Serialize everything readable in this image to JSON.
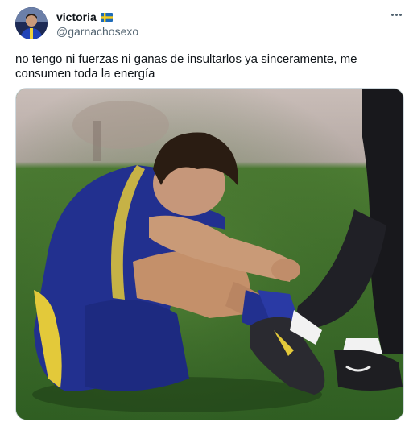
{
  "tweet": {
    "author": {
      "display_name": "victoria",
      "handle": "@garnachosexo",
      "flag_icon": "sweden-flag-icon",
      "avatar_icon": "avatar"
    },
    "text": "no tengo ni fuerzas ni ganas de insultarlos ya sinceramente, me consumen toda la energía",
    "more_icon": "more-options-icon",
    "media": {
      "kind": "photo",
      "description_icon": "photo-soccer-player-sitting-on-grass"
    }
  },
  "colors": {
    "text_primary": "#0f1419",
    "text_secondary": "#536471",
    "border": "#cfd9de",
    "pitch_green": "#3c6a2a",
    "jersey_blue": "#22308f",
    "jersey_yellow": "#e3c93a"
  }
}
